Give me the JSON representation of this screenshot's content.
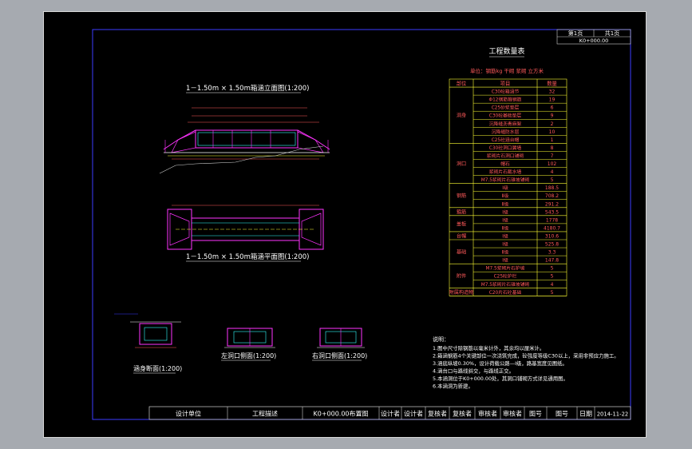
{
  "sheet": {
    "sheet_no_label": "第1页",
    "sheet_total_label": "共1页",
    "station": "K0+000.00"
  },
  "quantity_table": {
    "title": "工程数量表",
    "unit_note": "单位：钢筋kg  干砌  浆砌  立方米",
    "headers": [
      "部位",
      "项目",
      "数量"
    ],
    "groups": [
      {
        "name": "洞身",
        "items": [
          {
            "item": "C30砼箱涵节",
            "qty": "32"
          },
          {
            "item": "Φ12钢筋箍钢筋",
            "qty": "19"
          },
          {
            "item": "C25砂浆垫层",
            "qty": "6"
          },
          {
            "item": "C30砼基础垫层",
            "qty": "9"
          },
          {
            "item": "沉降缝沥青麻絮",
            "qty": "2"
          },
          {
            "item": "沉降缝防水层",
            "qty": "10"
          },
          {
            "item": "C25砼涵台帽",
            "qty": "1"
          }
        ]
      },
      {
        "name": "洞口",
        "items": [
          {
            "item": "C30砼洞口翼墙",
            "qty": "8"
          },
          {
            "item": "浆砌片石洞口铺砌",
            "qty": "7"
          },
          {
            "item": "帽石",
            "qty": "102"
          },
          {
            "item": "浆砌片石截水墙",
            "qty": "4"
          },
          {
            "item": "M7.5浆砌片石锥坡铺砌",
            "qty": "5"
          }
        ]
      },
      {
        "name": "钢筋",
        "items": [
          {
            "item": "Ⅰ级",
            "qty": "188.5"
          },
          {
            "item": "Ⅱ级",
            "qty": "708.2"
          },
          {
            "item": "Ⅱ级",
            "qty": "291.2"
          }
        ]
      },
      {
        "name": "箍筋",
        "items": [
          {
            "item": "Ⅰ级",
            "qty": "543.5"
          }
        ]
      },
      {
        "name": "盖板",
        "items": [
          {
            "item": "Ⅰ级",
            "qty": "1778"
          },
          {
            "item": "Ⅱ级",
            "qty": "4180.7"
          }
        ]
      },
      {
        "name": "台帽",
        "items": [
          {
            "item": "Ⅰ级",
            "qty": "310.6"
          }
        ]
      },
      {
        "name": "基础",
        "items": [
          {
            "item": "Ⅰ级",
            "qty": "525.8"
          },
          {
            "item": "Ⅱ级",
            "qty": "3.3"
          },
          {
            "item": "Ⅰ级",
            "qty": "147.8"
          }
        ]
      },
      {
        "name": "附件",
        "items": [
          {
            "item": "M7.5浆砌片石护坡",
            "qty": "5"
          },
          {
            "item": "C25砼护栏",
            "qty": "5"
          },
          {
            "item": "M7.5浆砌片石锥坡铺砌",
            "qty": "4"
          }
        ]
      },
      {
        "name": "附属构造物",
        "items": [
          {
            "item": "C20片石砼基础",
            "qty": "5"
          }
        ]
      }
    ]
  },
  "drawings": {
    "elevation_title": "1－1.50m × 1.50m箱涵立面图(1:200)",
    "plan_title": "1－1.50m × 1.50m箱涵平面图(1:200)",
    "cross_section_title": "涵身断面(1:200)",
    "left_portal_title": "左洞口侧面(1:200)",
    "right_portal_title": "右洞口侧面(1:200)"
  },
  "notes": {
    "heading": "说明：",
    "lines": [
      "1.图中尺寸除钢筋以毫米计外，其余均以厘米计。",
      "2.箱涵钢筋4个关键部位一次浇筑完成，砼强度等级C30以上，采用非预应力施工。",
      "3.涵底纵坡0.30%，设计荷载公路—Ⅰ级，路基宽度见图纸。",
      "4.涵台口与路线斜交，与路线正交。",
      "5.本涵洞位于K0+000.00处，其洞口铺砌方式详见通用图。",
      "6.本涵洞为新建。"
    ]
  },
  "title_block": {
    "cells": [
      "设计单位",
      "工程描述",
      "K0+000.00布置图",
      "设计者",
      "设计者",
      "复核者",
      "复核者",
      "审核者",
      "审核者",
      "图号",
      "图号",
      "日期",
      "2014-11-22"
    ]
  },
  "colors": {
    "background": "#000000",
    "frame": "#3b3bff",
    "table_line": "#ffff33",
    "text": "#ff5a5a",
    "drawing": "#ff33ff",
    "accent": "#33ffff",
    "white": "#ffffff"
  }
}
